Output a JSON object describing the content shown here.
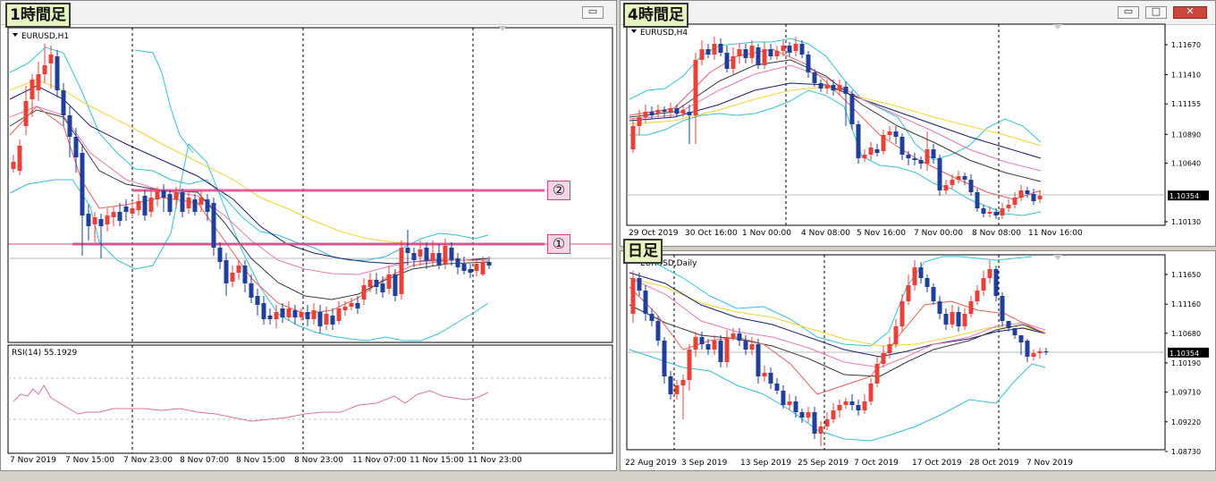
{
  "h1": {
    "badge": "1時間足",
    "symbol": "EURUSD,H1",
    "rsi_label": "RSI(14) 55.1929",
    "x_labels": [
      "7 Nov 2019",
      "7 Nov 15:00",
      "7 Nov 23:00",
      "8 Nov 07:00",
      "8 Nov 15:00",
      "8 Nov 23:00",
      "11 Nov 07:00",
      "11 Nov 15:00",
      "11 Nov 23:00"
    ],
    "markers": [
      "②",
      "①"
    ]
  },
  "h4": {
    "badge": "4時間足",
    "symbol": "EURUSD,H4",
    "x_labels": [
      "29 Oct 2019",
      "30 Oct 16:00",
      "1 Nov 00:00",
      "4 Nov 08:00",
      "5 Nov 16:00",
      "7 Nov 00:00",
      "8 Nov 08:00",
      "11 Nov 16:00"
    ],
    "y_labels": [
      "1.11670",
      "1.11410",
      "1.11155",
      "1.10890",
      "1.10640",
      "1.10354",
      "1.10130"
    ],
    "y_values": [
      1.1167,
      1.1141,
      1.11155,
      1.1089,
      1.1064,
      1.10354,
      1.1013
    ],
    "current_price": "1.10354"
  },
  "d1": {
    "badge": "日足",
    "symbol": "EURUSD,Daily",
    "x_labels": [
      "22 Aug 2019",
      "3 Sep 2019",
      "13 Sep 2019",
      "25 Sep 2019",
      "7 Oct 2019",
      "17 Oct 2019",
      "28 Oct 2019",
      "7 Nov 2019"
    ],
    "y_labels": [
      "1.11650",
      "1.11160",
      "1.10680",
      "1.10354",
      "1.10190",
      "1.09710",
      "1.09220",
      "1.08730"
    ],
    "y_values": [
      1.1165,
      1.1116,
      1.1068,
      1.10354,
      1.1019,
      1.0971,
      1.0922,
      1.0873
    ],
    "current_price": "1.10354"
  },
  "colors": {
    "bull": "#e8413a",
    "bear": "#1f3f9a",
    "bb": "#33c0d6",
    "ma_black": "#3a3a3a",
    "ma_navy": "#16206e",
    "ma_yellow": "#f2d230",
    "ma_pink": "#e878b4",
    "ma_red": "#e2605c",
    "rsi": "#e070a0",
    "hline": "#e0408a"
  }
}
